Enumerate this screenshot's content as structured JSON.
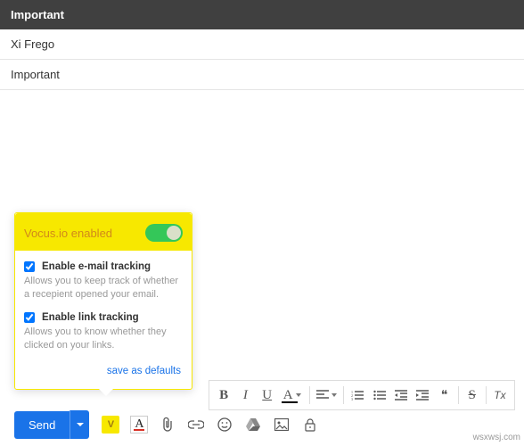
{
  "header": {
    "title": "Important"
  },
  "fields": {
    "to": "Xi Frego",
    "subject": "Important"
  },
  "popup": {
    "title": "Vocus.io enabled",
    "options": [
      {
        "label": "Enable e-mail tracking",
        "desc": "Allows you to keep track of whether a recepient opened your email.",
        "checked": true
      },
      {
        "label": "Enable link tracking",
        "desc": "Allows you to know whether they clicked on your links.",
        "checked": true
      }
    ],
    "save_link": "save as defaults"
  },
  "format_bar": {
    "bold": "B",
    "italic": "I",
    "underline": "U",
    "textcolor": "A",
    "quote": "❝",
    "strike": "S",
    "tx": "Tx"
  },
  "action_bar": {
    "send_label": "Send",
    "vocus_badge": "V",
    "text_color": "A"
  },
  "watermark": "wsxwsj.com"
}
